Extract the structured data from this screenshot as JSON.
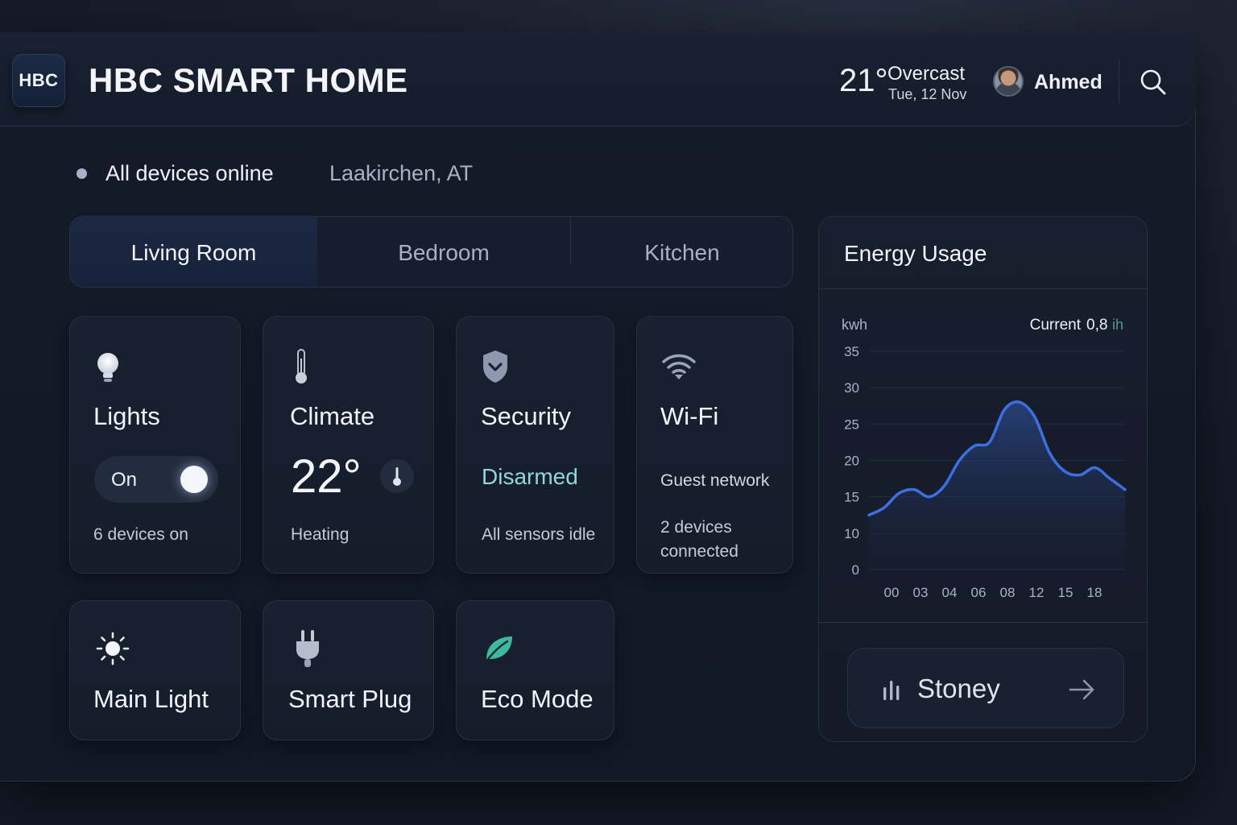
{
  "app": {
    "logo_text": "HBC",
    "title": "HBC SMART HOME"
  },
  "header": {
    "temperature": "21°",
    "condition": "Overcast",
    "date": "Tue, 12 Nov",
    "user_name": "Ahmed"
  },
  "status": {
    "text": "All devices online",
    "location": "Laakirchen, AT"
  },
  "tabs": [
    {
      "label": "Living Room",
      "active": true
    },
    {
      "label": "Bedroom",
      "active": false
    },
    {
      "label": "Kitchen",
      "active": false
    }
  ],
  "cards": {
    "lights": {
      "title": "Lights",
      "toggle_label": "On",
      "toggle_on": true,
      "sub": "6 devices on",
      "icon": "bulb-icon"
    },
    "climate": {
      "title": "Climate",
      "temperature": "22°",
      "sub": "Heating",
      "icon": "thermometer-icon"
    },
    "security": {
      "title": "Security",
      "state": "Disarmed",
      "sub": "All sensors idle",
      "icon": "shield-icon"
    },
    "wifi": {
      "title": "Wi-Fi",
      "network": "Guest network",
      "sub_line1": "2 devices",
      "sub_line2": "connected",
      "icon": "wifi-icon"
    },
    "main_light": {
      "title": "Main Light",
      "icon": "sun-icon"
    },
    "smart_plug": {
      "title": "Smart Plug",
      "icon": "plug-icon"
    },
    "eco_mode": {
      "title": "Eco Mode",
      "icon": "leaf-icon"
    }
  },
  "energy": {
    "title": "Energy Usage",
    "unit_label": "kwh",
    "current_label": "Current",
    "current_value": "0,8",
    "current_unit": "ih",
    "stoney_label": "Stoney"
  },
  "colors": {
    "accent_line": "#3d6fe0",
    "disarmed": "#8fd7d9",
    "eco_leaf": "#3fb8a0"
  },
  "chart_data": {
    "type": "area",
    "ylabel": "kwh",
    "y_ticks": [
      "0",
      "10",
      "15",
      "20",
      "25",
      "30",
      "35"
    ],
    "x_ticks": [
      "00",
      "03",
      "04",
      "06",
      "08",
      "12",
      "15",
      "18"
    ],
    "series": [
      {
        "x": [
          0,
          0.5,
          1,
          1.5,
          2,
          2.5,
          3,
          3.5,
          4,
          4.5,
          5,
          5.5,
          6,
          6.5,
          7,
          7.5,
          8,
          8.5
        ],
        "values": [
          12.5,
          13.5,
          15.5,
          16,
          15,
          16.5,
          20,
          22,
          22.5,
          27,
          28,
          26,
          21,
          18.5,
          18,
          19,
          17.5,
          16
        ]
      }
    ],
    "grid": true
  }
}
